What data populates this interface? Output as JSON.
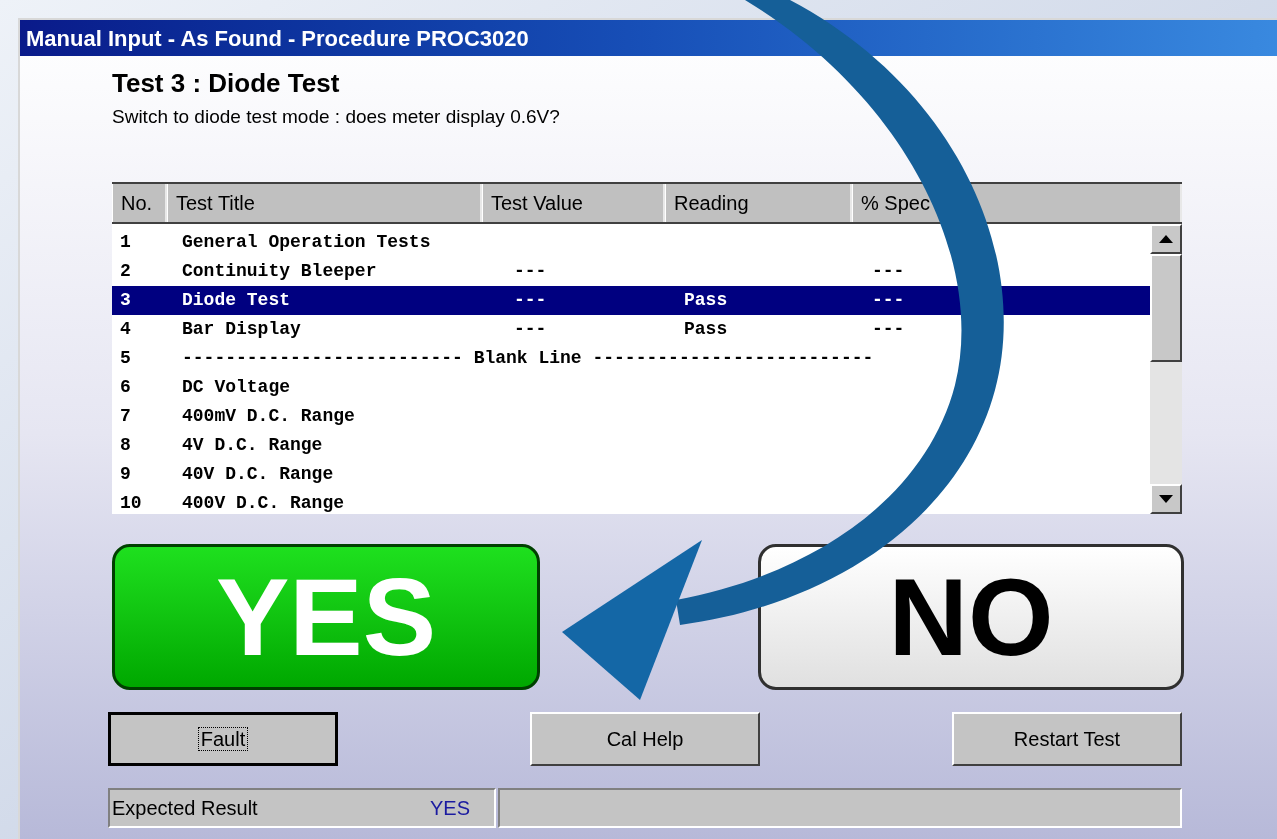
{
  "window": {
    "title": "Manual Input - As Found - Procedure PROC3020"
  },
  "test": {
    "title": "Test 3 : Diode Test",
    "instruction": "Switch to diode test mode : does meter display 0.6V?"
  },
  "table": {
    "columns": [
      "No.",
      "Test Title",
      "Test Value",
      "Reading",
      "% Spec"
    ],
    "rows": [
      {
        "kind": "test",
        "cells": [
          "1",
          "General Operation Tests",
          "",
          "",
          ""
        ],
        "selected": false
      },
      {
        "kind": "test",
        "cells": [
          "2",
          "Continuity Bleeper",
          "---",
          "",
          "---"
        ],
        "selected": false
      },
      {
        "kind": "test",
        "cells": [
          "3",
          "Diode Test",
          "---",
          "Pass",
          "---"
        ],
        "selected": true
      },
      {
        "kind": "test",
        "cells": [
          "4",
          "Bar Display",
          "---",
          "Pass",
          "---"
        ],
        "selected": false
      },
      {
        "kind": "separator",
        "cells": [
          "5",
          "-------------------------- Blank Line --------------------------"
        ],
        "selected": false
      },
      {
        "kind": "test",
        "cells": [
          "6",
          "DC Voltage",
          "",
          "",
          ""
        ],
        "selected": false
      },
      {
        "kind": "test",
        "cells": [
          "7",
          "400mV D.C. Range",
          "",
          "",
          ""
        ],
        "selected": false
      },
      {
        "kind": "test",
        "cells": [
          "8",
          "4V D.C. Range",
          "",
          "",
          ""
        ],
        "selected": false
      },
      {
        "kind": "test",
        "cells": [
          "9",
          "40V D.C. Range",
          "",
          "",
          ""
        ],
        "selected": false
      },
      {
        "kind": "test",
        "cells": [
          "10",
          "400V D.C. Range",
          "",
          "",
          ""
        ],
        "selected": false
      }
    ]
  },
  "answers": {
    "yes": "YES",
    "no": "NO"
  },
  "buttons": [
    {
      "label": "Fault",
      "focused": true
    },
    {
      "label": "Cal Help",
      "focused": false
    },
    {
      "label": "Restart Test",
      "focused": false
    }
  ],
  "status_bar": {
    "label": "Expected Result",
    "value": "YES"
  }
}
